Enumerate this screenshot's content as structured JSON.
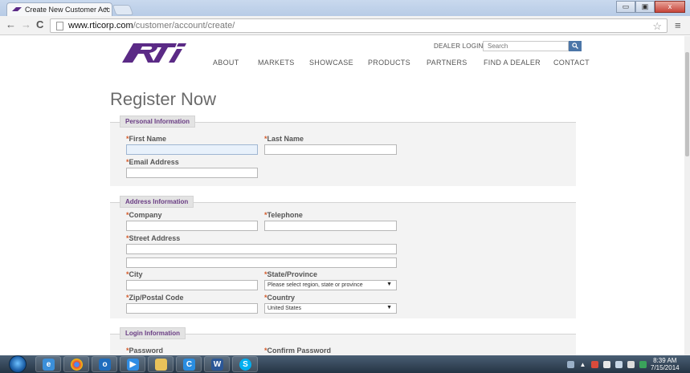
{
  "browser": {
    "tab_title": "Create New Customer Acc",
    "tab_close": "×",
    "url_host": "www.rticorp.com",
    "url_path": "/customer/account/create/",
    "back": "←",
    "forward": "→",
    "reload": "C",
    "menu": "≡",
    "star": "☆"
  },
  "window": {
    "minimize": "▭",
    "maximize": "▣",
    "close": "x"
  },
  "header": {
    "logo_text": "RTI",
    "dealer_login": "DEALER LOGIN",
    "search_placeholder": "Search",
    "search_icon": "search-icon",
    "nav": [
      "ABOUT",
      "MARKETS",
      "SHOWCASE",
      "PRODUCTS",
      "PARTNERS",
      "FIND A DEALER",
      "CONTACT"
    ]
  },
  "page": {
    "title": "Register Now",
    "required_marker": "*",
    "sections": {
      "personal": {
        "legend": "Personal Information",
        "first_name": "First Name",
        "last_name": "Last Name",
        "email": "Email Address"
      },
      "address": {
        "legend": "Address Information",
        "company": "Company",
        "telephone": "Telephone",
        "street": "Street Address",
        "city": "City",
        "state": "State/Province",
        "state_value": "Please select region, state or province",
        "zip": "Zip/Postal Code",
        "country": "Country",
        "country_value": "United States"
      },
      "login": {
        "legend": "Login Information",
        "password": "Password",
        "confirm_password": "Confirm Password"
      }
    }
  },
  "taskbar": {
    "clock_time": "8:39 AM",
    "clock_date": "7/15/2014",
    "apps": [
      "ie",
      "chrome",
      "outlook",
      "media",
      "explorer",
      "chrome-app",
      "word",
      "skype"
    ]
  },
  "colors": {
    "brand_purple": "#5b2a86",
    "legend_text": "#6a3d84",
    "required": "#d35a2a",
    "search_button": "#4c76a8"
  }
}
